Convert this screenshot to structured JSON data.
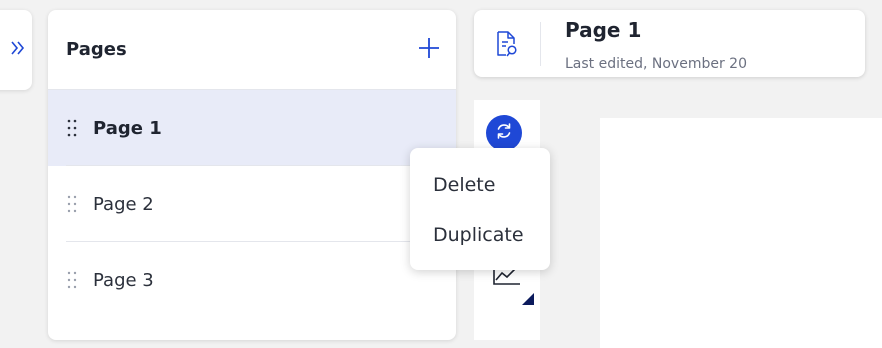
{
  "sidebar": {
    "expand_icon": "double-chevron-right-icon",
    "title": "Pages",
    "add_icon": "plus-icon",
    "items": [
      {
        "label": "Page 1",
        "selected": true
      },
      {
        "label": "Page 2",
        "selected": false
      },
      {
        "label": "Page 3",
        "selected": false
      }
    ]
  },
  "page_header": {
    "icon": "document-search-icon",
    "title": "Page 1",
    "subtitle": "Last edited, November 20"
  },
  "toolbar": {
    "refresh_icon": "refresh-icon",
    "chart_icon": "line-chart-icon"
  },
  "context_menu": {
    "items": [
      "Delete",
      "Duplicate"
    ]
  },
  "colors": {
    "accent": "#1f48d6",
    "selected_row": "#e8ebf8",
    "background": "#f2f2f2"
  }
}
